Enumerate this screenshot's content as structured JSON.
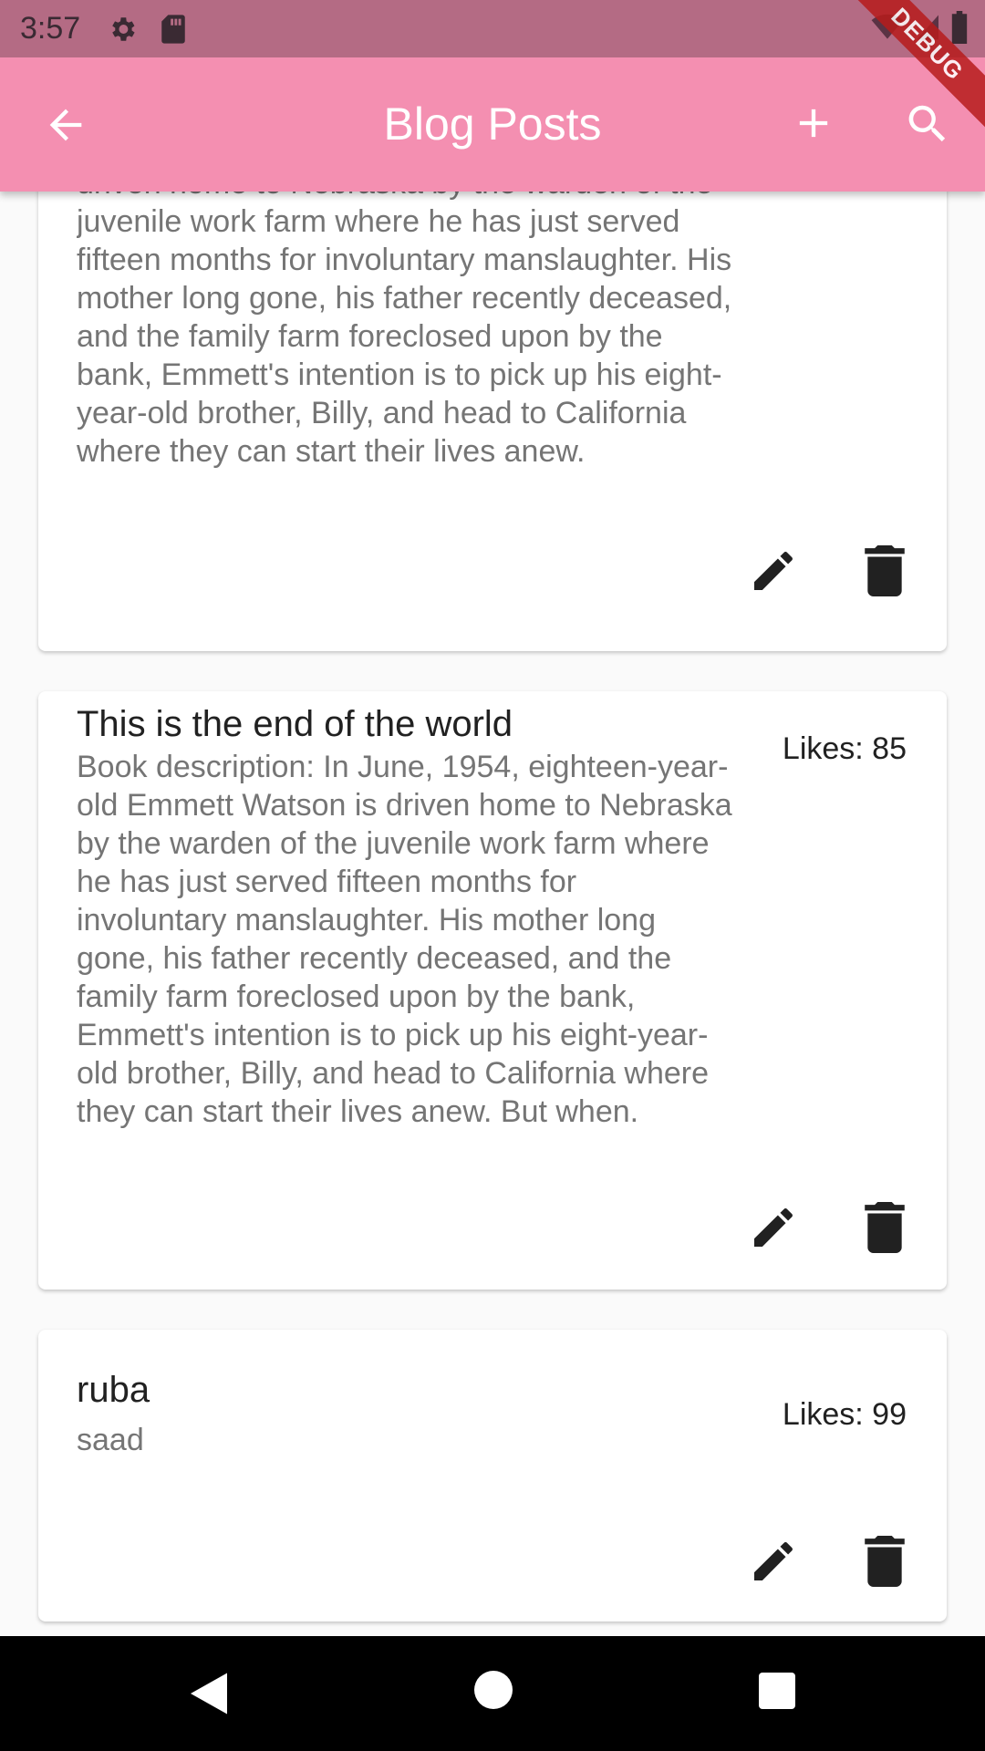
{
  "status_bar": {
    "time": "3:57",
    "icons": [
      "settings-icon",
      "sd-card-icon",
      "wifi-icon",
      "signal-icon",
      "battery-icon"
    ]
  },
  "app_bar": {
    "title": "Blog Posts",
    "background": "#f48fb1",
    "icons": [
      "back-arrow-icon",
      "add-icon",
      "search-icon"
    ]
  },
  "debug_banner": "DEBUG",
  "posts": [
    {
      "description": "driven home to Nebraska by the warden of the juvenile work farm where he has just served fifteen months for involuntary manslaughter. His mother long gone, his father recently deceased, and the family farm foreclosed upon by the bank, Emmett's intention is to pick up his eight-year-old brother, Billy, and head to California where they can start their lives anew."
    },
    {
      "title": "This is the end of the world",
      "likes": "Likes: 85",
      "description": "Book description: In June, 1954, eighteen-year-old Emmett Watson is driven home to Nebraska by the warden of the juvenile work farm where he has just served fifteen months for involuntary manslaughter. His mother long gone, his father recently deceased, and the family farm foreclosed upon by the bank, Emmett's intention is to pick up his eight-year-old brother, Billy, and head to California where they can start their lives anew. But when."
    },
    {
      "title": "ruba",
      "likes": "Likes: 99",
      "description": "saad"
    }
  ]
}
